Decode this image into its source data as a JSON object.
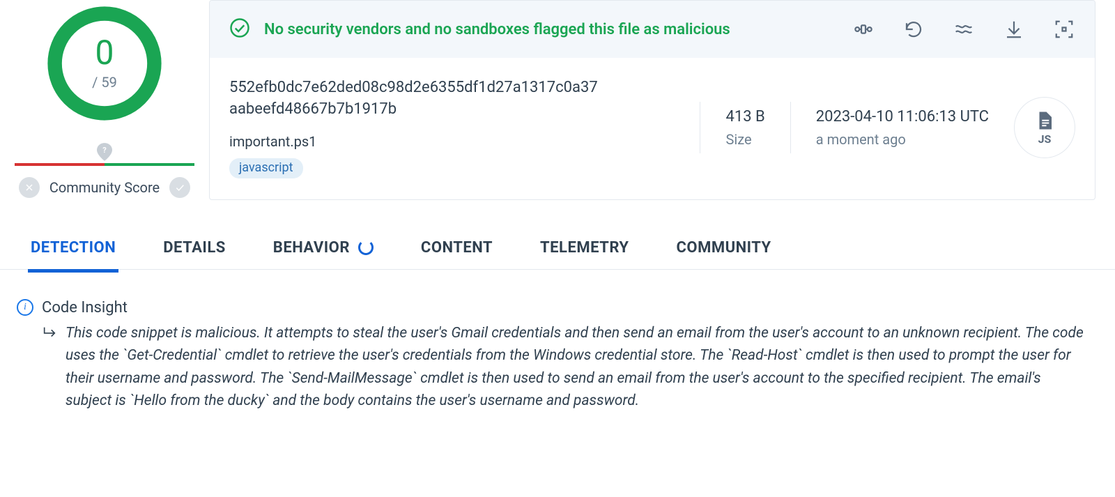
{
  "score": {
    "detections": "0",
    "engines_total": "/ 59"
  },
  "community_score_label": "Community Score",
  "verdict": {
    "text": "No security vendors and no sandboxes flagged this file as malicious"
  },
  "action_icons": {
    "graph": "graph-icon",
    "reanalyze": "reanalyze-icon",
    "similar": "similar-icon",
    "download": "download-icon",
    "scan": "scan-icon"
  },
  "file": {
    "hash": "552efb0dc7e62ded08c98d2e6355df1d27a1317c0a37aabeefd48667b7b1917b",
    "name": "important.ps1",
    "tag": "javascript",
    "size_value": "413 B",
    "size_label": "Size",
    "date_value": "2023-04-10 11:06:13 UTC",
    "date_label": "a moment ago",
    "type_label": "JS"
  },
  "tabs": {
    "detection": "DETECTION",
    "details": "DETAILS",
    "behavior": "BEHAVIOR",
    "content": "CONTENT",
    "telemetry": "TELEMETRY",
    "community": "COMMUNITY"
  },
  "insight": {
    "title": "Code Insight",
    "body": "This code snippet is malicious. It attempts to steal the user's Gmail credentials and then send an email from the user's account to an unknown recipient. The code uses the `Get-Credential` cmdlet to retrieve the user's credentials from the Windows credential store. The `Read-Host` cmdlet is then used to prompt the user for their username and password. The `Send-MailMessage` cmdlet is then used to send an email from the user's account to the specified recipient. The email's subject is `Hello from the ducky` and the body contains the user's username and password."
  }
}
